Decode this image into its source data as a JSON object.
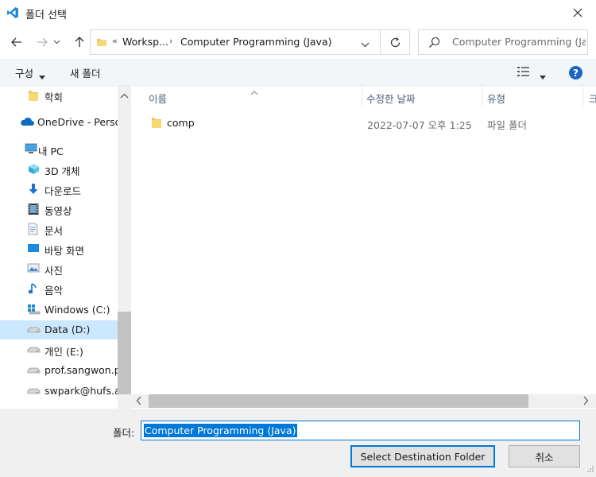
{
  "window": {
    "title": "폴더 선택",
    "accent": "#0078d7"
  },
  "address": {
    "overflow_chevron": "«",
    "crumb_parent": "Worksp...",
    "separator": "›",
    "crumb_current": "Computer Programming (Java)"
  },
  "search": {
    "placeholder": "Computer Programming (Ja..."
  },
  "toolbar": {
    "organize_label": "구성",
    "new_folder_label": "새 폴더",
    "help_label": "?"
  },
  "nav": {
    "items": [
      {
        "label": "학회",
        "icon": "folder-icon"
      },
      {
        "label": "OneDrive - Personal",
        "icon": "cloud-icon"
      },
      {
        "label": "내 PC",
        "icon": "computer-icon"
      },
      {
        "label": "3D 개체",
        "icon": "cube-icon"
      },
      {
        "label": "다운로드",
        "icon": "download-icon"
      },
      {
        "label": "동영상",
        "icon": "video-icon"
      },
      {
        "label": "문서",
        "icon": "document-icon"
      },
      {
        "label": "바탕 화면",
        "icon": "desktop-icon"
      },
      {
        "label": "사진",
        "icon": "picture-icon"
      },
      {
        "label": "음악",
        "icon": "music-icon"
      },
      {
        "label": "Windows (C:)",
        "icon": "windows-drive-icon"
      },
      {
        "label": "Data (D:)",
        "icon": "drive-icon",
        "selected": true
      },
      {
        "label": "개인 (E:)",
        "icon": "drive-icon"
      },
      {
        "label": "prof.sangwon.park",
        "icon": "drive-icon"
      },
      {
        "label": "swpark@hufs.ac.kr",
        "icon": "drive-icon"
      }
    ]
  },
  "columns": {
    "name": "이름",
    "modified": "수정한 날짜",
    "type": "유형",
    "size": "크"
  },
  "files": [
    {
      "name": "comp",
      "modified": "2022-07-07 오후 1:25",
      "type": "파일 폴더"
    }
  ],
  "bottom": {
    "folder_label": "폴더:",
    "folder_value": "Computer Programming (Java)",
    "select_label": "Select Destination Folder",
    "cancel_label": "취소"
  }
}
